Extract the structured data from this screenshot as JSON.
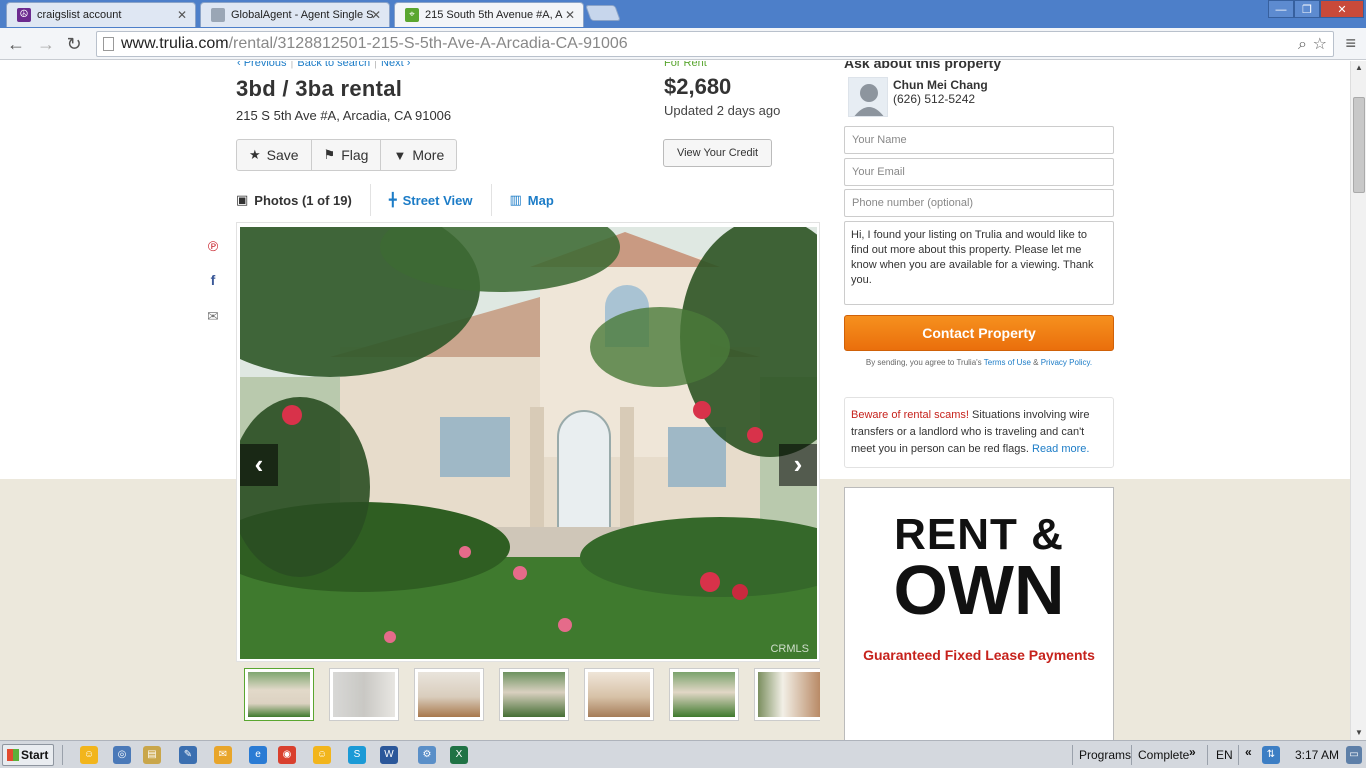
{
  "browser": {
    "tabs": [
      {
        "title": "craigslist account",
        "favicon": "peace-icon",
        "favicon_color": "#6b2a8f"
      },
      {
        "title": "GlobalAgent - Agent Single S",
        "favicon": "page-icon",
        "favicon_color": "#9aa6b5"
      },
      {
        "title": "215 South 5th Avenue #A, A",
        "favicon": "trulia-icon",
        "favicon_color": "#5aa630"
      }
    ],
    "url_host": "www.trulia.com",
    "url_path": "/rental/3128812501-215-S-5th-Ave-A-Arcadia-CA-91006"
  },
  "listing": {
    "nav_previous": "‹ Previous",
    "nav_back": "Back to search",
    "nav_next": "Next ›",
    "title": "3bd / 3ba rental",
    "address": "215 S 5th Ave #A, Arcadia, CA 91006",
    "status_label": "For Rent",
    "price": "$2,680",
    "updated": "Updated 2 days ago",
    "save_label": "Save",
    "flag_label": "Flag",
    "more_label": "More",
    "credit_label": "View Your Credit",
    "photos_tab": "Photos (1 of 19)",
    "street_view_tab": "Street View",
    "map_tab": "Map",
    "photo_watermark": "CRMLS",
    "thumbnail_count": 7,
    "selected_thumbnail": 1
  },
  "contact": {
    "heading": "Ask about this property",
    "agent_name": "Chun Mei Chang",
    "agent_phone": "(626) 512-5242",
    "name_placeholder": "Your Name",
    "email_placeholder": "Your Email",
    "phone_placeholder": "Phone number (optional)",
    "message": "Hi, I found your listing on Trulia and would like to find out more about this property. Please let me know when you are available for a viewing. Thank you.",
    "contact_button": "Contact Property",
    "terms_prefix": "By sending, you agree to Trulia's",
    "terms_of_use": "Terms of Use",
    "terms_amp": "&",
    "privacy_policy": "Privacy Policy.",
    "scam_warning": "Beware of rental scams!",
    "scam_text": " Situations involving wire transfers or a landlord who is traveling and can't meet you in person can be red flags. ",
    "scam_link": "Read more."
  },
  "ad": {
    "line1": "RENT &",
    "line2": "OWN",
    "tagline": "Guaranteed Fixed Lease Payments"
  },
  "taskbar": {
    "start": "Start",
    "programs": "Programs",
    "complete": "Complete",
    "chevron": "»",
    "language": "EN",
    "tray_arrow": "«",
    "clock": "3:17 AM"
  },
  "colors": {
    "link_blue": "#1c7cc7",
    "accent_green": "#5aa630",
    "cta_orange": "#f07b14",
    "warning_red": "#c6221c",
    "lower_page_background": "#ece8dc"
  }
}
